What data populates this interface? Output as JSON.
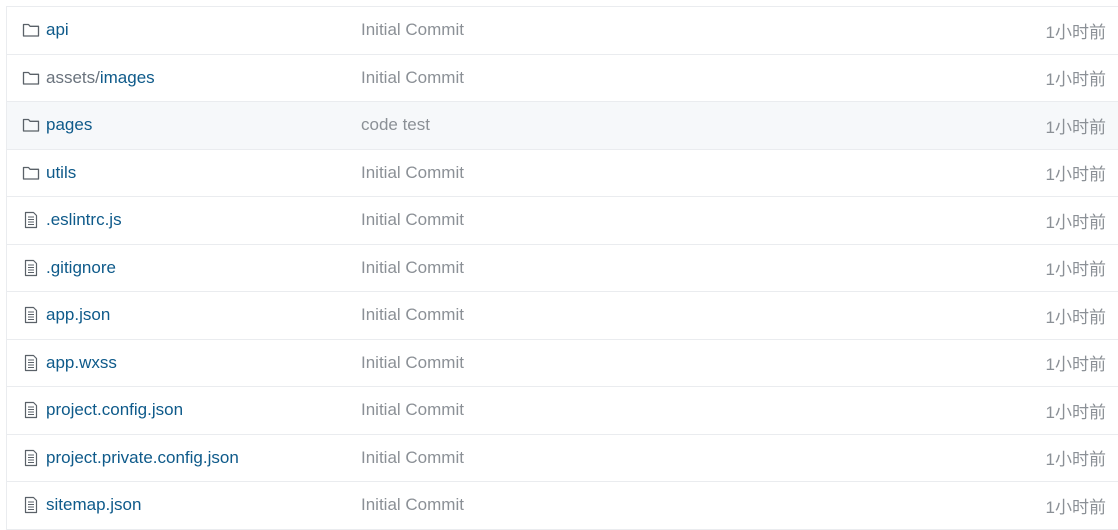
{
  "colors": {
    "link": "#0e5a8a",
    "muted": "#8b9096",
    "border": "#eaecef",
    "highlight_bg": "#f6f8fa"
  },
  "files": [
    {
      "icon": "folder-icon",
      "prefix": "",
      "name": "api",
      "commit": "Initial Commit",
      "time": "1小时前"
    },
    {
      "icon": "folder-icon",
      "prefix": "assets/",
      "name": "images",
      "commit": "Initial Commit",
      "time": "1小时前"
    },
    {
      "icon": "folder-icon",
      "prefix": "",
      "name": "pages",
      "commit": "code test",
      "time": "1小时前",
      "highlighted": true
    },
    {
      "icon": "folder-icon",
      "prefix": "",
      "name": "utils",
      "commit": "Initial Commit",
      "time": "1小时前"
    },
    {
      "icon": "file-icon",
      "prefix": "",
      "name": ".eslintrc.js",
      "commit": "Initial Commit",
      "time": "1小时前"
    },
    {
      "icon": "file-icon",
      "prefix": "",
      "name": ".gitignore",
      "commit": "Initial Commit",
      "time": "1小时前"
    },
    {
      "icon": "file-icon",
      "prefix": "",
      "name": "app.json",
      "commit": "Initial Commit",
      "time": "1小时前"
    },
    {
      "icon": "file-icon",
      "prefix": "",
      "name": "app.wxss",
      "commit": "Initial Commit",
      "time": "1小时前"
    },
    {
      "icon": "file-icon",
      "prefix": "",
      "name": "project.config.json",
      "commit": "Initial Commit",
      "time": "1小时前"
    },
    {
      "icon": "file-icon",
      "prefix": "",
      "name": "project.private.config.json",
      "commit": "Initial Commit",
      "time": "1小时前"
    },
    {
      "icon": "file-icon",
      "prefix": "",
      "name": "sitemap.json",
      "commit": "Initial Commit",
      "time": "1小时前"
    }
  ]
}
